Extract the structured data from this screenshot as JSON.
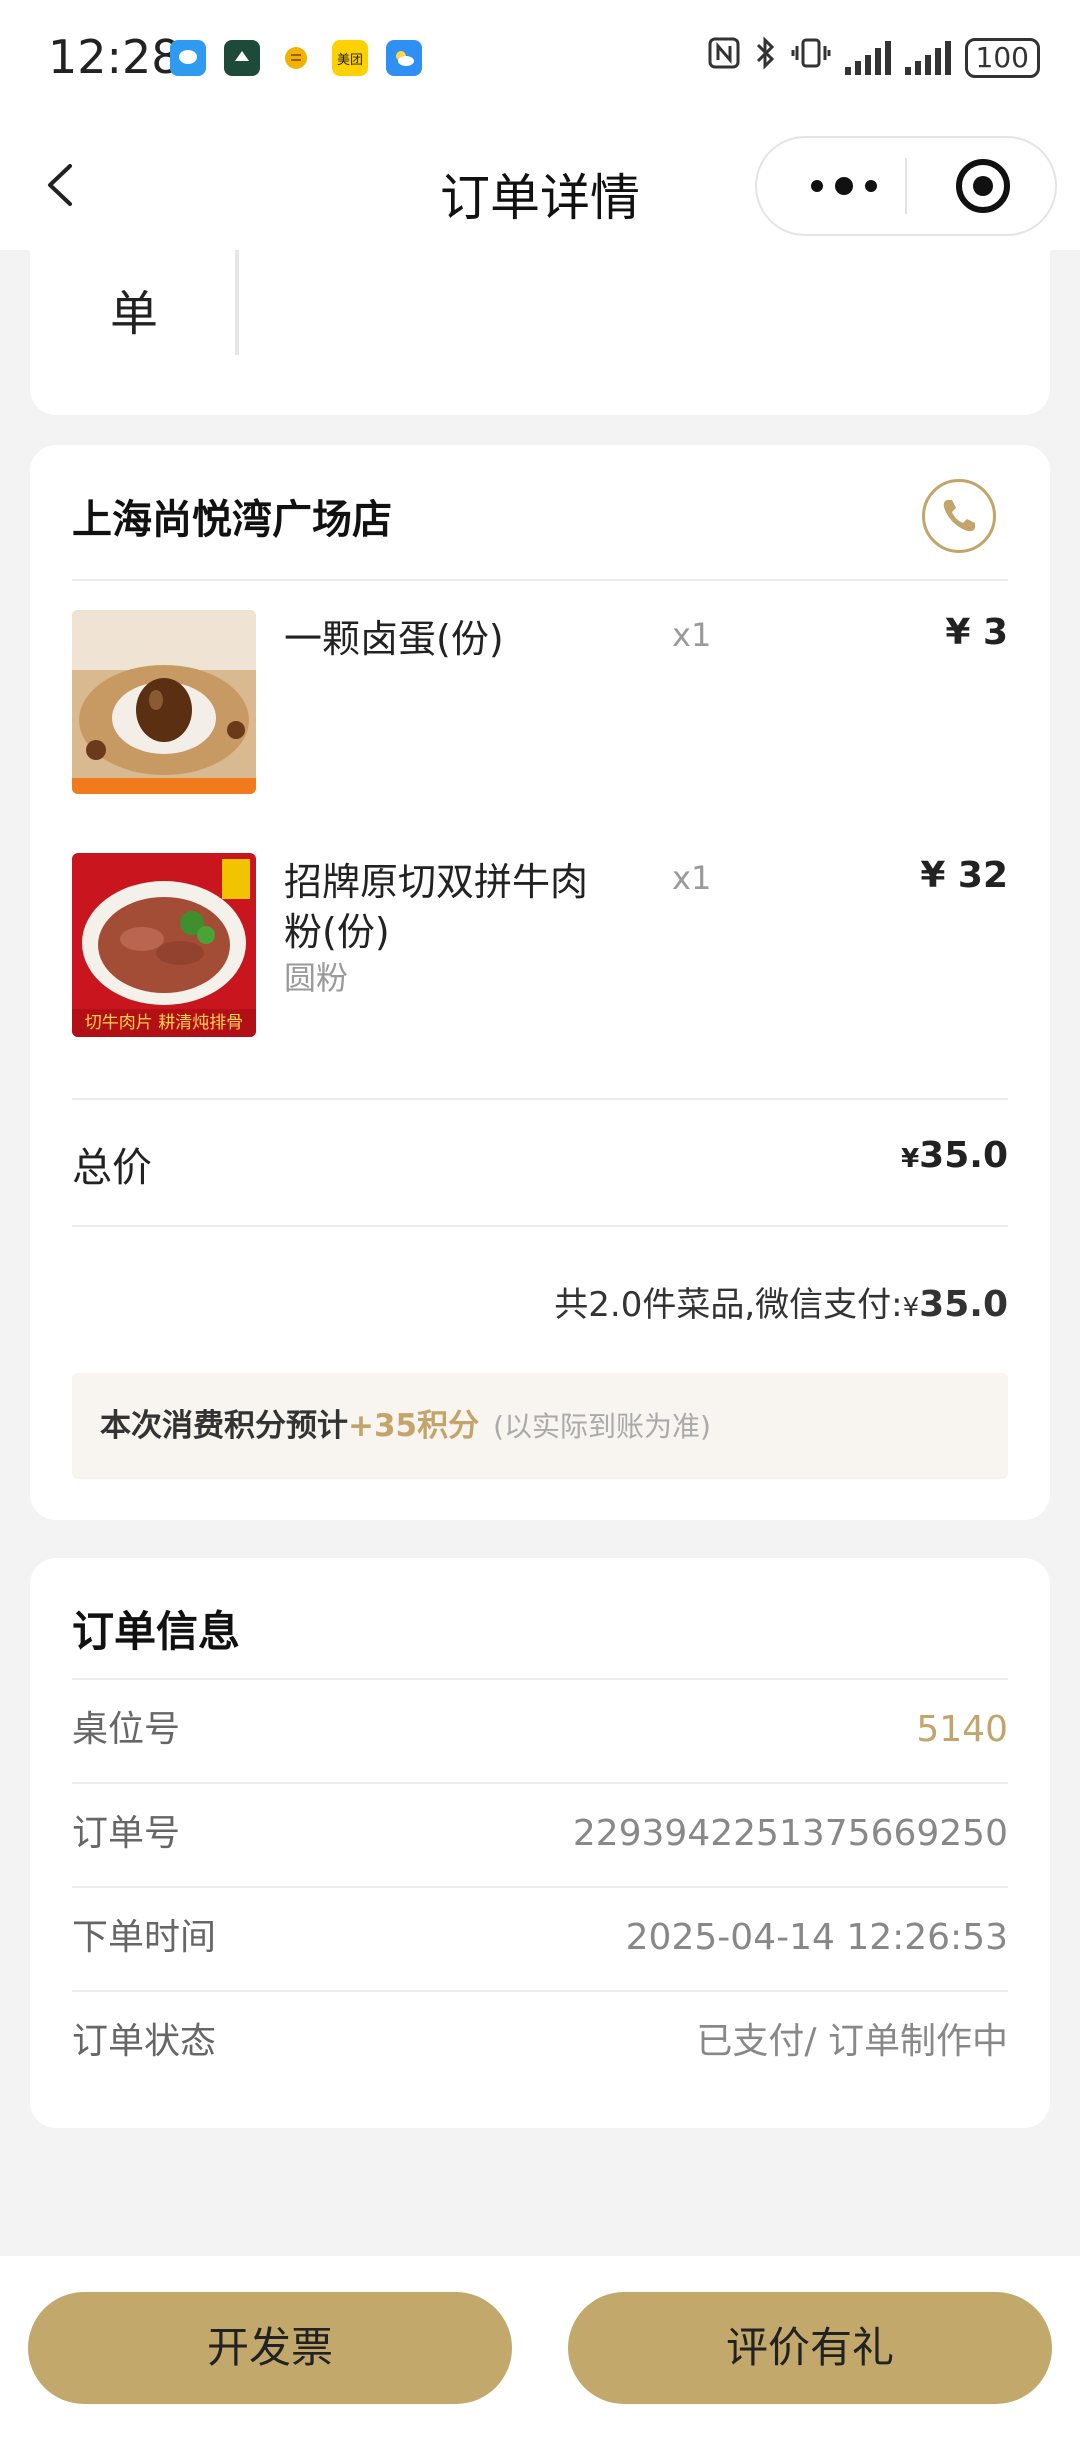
{
  "status_bar": {
    "time": "12:28",
    "battery": "100",
    "notif_icons": [
      "message-icon",
      "app-icon",
      "bank-icon",
      "meituan-icon",
      "weather-icon"
    ],
    "meituan_label": "美团"
  },
  "nav": {
    "title": "订单详情"
  },
  "top_card": {
    "partial_text": "单"
  },
  "order": {
    "store_name": "上海尚悦湾广场店",
    "items": [
      {
        "name": "一颗卤蛋(份)",
        "qty": "x1",
        "price": "¥ 3",
        "spec": ""
      },
      {
        "name": "招牌原切双拼牛肉粉(份)",
        "qty": "x1",
        "price": "¥ 32",
        "spec": "圆粉",
        "image_caption": "切牛肉片 耕清炖排骨"
      }
    ],
    "total_label": "总价",
    "total_currency": "¥",
    "total_value": "35.0",
    "pay_prefix": "共2.0件菜品,微信支付:",
    "pay_currency": "¥",
    "pay_value": "35.0",
    "points_prefix": "本次消费积分预计",
    "points_value": "+35积分",
    "points_note": "(以实际到账为准)"
  },
  "info": {
    "title": "订单信息",
    "rows": [
      {
        "label": "桌位号",
        "value": "5140"
      },
      {
        "label": "订单号",
        "value": "2293942251375669250"
      },
      {
        "label": "下单时间",
        "value": "2025-04-14 12:26:53"
      },
      {
        "label": "订单状态",
        "value": "已支付/ 订单制作中"
      }
    ]
  },
  "buttons": {
    "invoice": "开发票",
    "review": "评价有礼"
  },
  "colors": {
    "accent": "#c3a46b",
    "button_bg": "#c3a86c",
    "background": "#f3f3f3"
  }
}
